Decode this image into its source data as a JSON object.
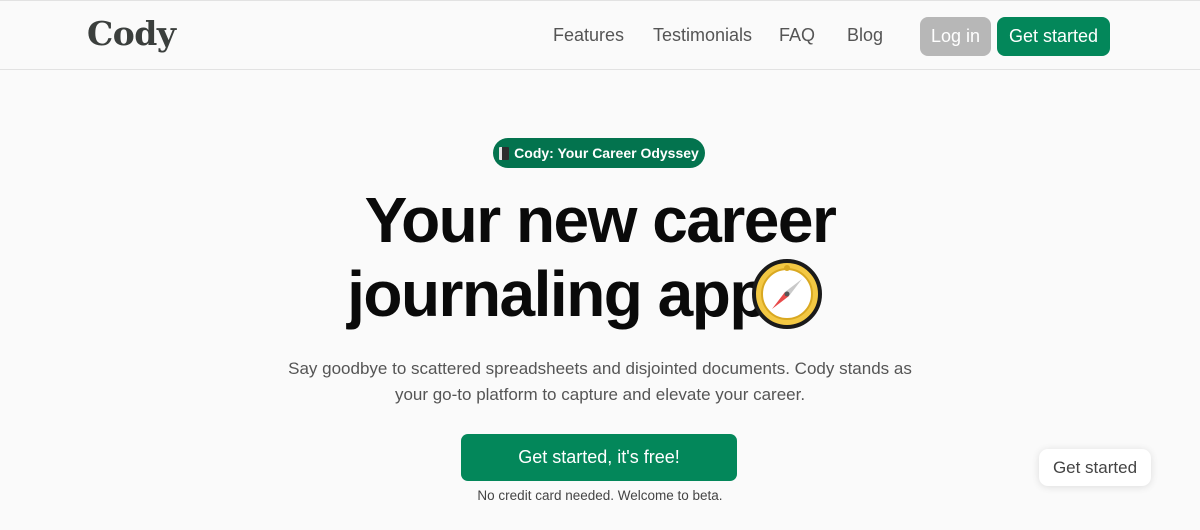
{
  "header": {
    "logo": "Cody",
    "nav": [
      "Features",
      "Testimonials",
      "FAQ",
      "Blog"
    ],
    "login_label": "Log in",
    "get_started_label": "Get started"
  },
  "hero": {
    "badge_label": "Cody: Your Career Odyssey",
    "badge_icon": "notebook-icon",
    "headline_line1": "Your new career",
    "headline_line2": "journaling app",
    "headline_icon": "compass-icon",
    "subtitle": "Say goodbye to scattered spreadsheets and disjointed documents. Cody stands as your go-to platform to capture and elevate your career.",
    "cta_label": "Get started, it's free!",
    "note": "No credit card needed. Welcome to beta."
  },
  "floating": {
    "get_started_label": "Get started"
  },
  "colors": {
    "brand_green": "#03875a",
    "badge_green": "#03734e",
    "login_gray": "#b7b7b7",
    "background": "#fafafa"
  }
}
